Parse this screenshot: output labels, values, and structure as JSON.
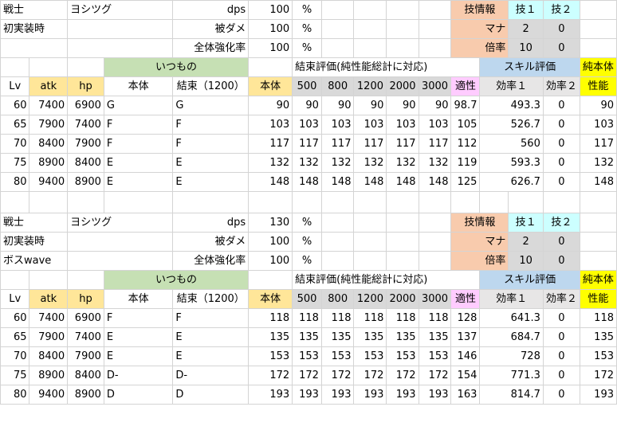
{
  "blocks": [
    {
      "row1": {
        "class": "戦士",
        "name": "ヨシツグ",
        "dps_label": "dps",
        "dps_value": "100",
        "dps_unit": "%",
        "skill_info": "技情報",
        "skill1": "技１",
        "skill2": "技２"
      },
      "row2": {
        "col_a": "初実装時",
        "col_b": "",
        "dmg_label": "被ダメ",
        "dmg_value": "100",
        "dmg_unit": "%",
        "mana_label": "マナ",
        "mana1": "2",
        "mana2": "0"
      },
      "row3": {
        "col_a": "",
        "col_b": "",
        "boost_label": "全体強化率",
        "boost_value": "100",
        "boost_unit": "%",
        "mult_label": "倍率",
        "mult1": "10",
        "mult2": "0"
      },
      "row4": {
        "itsumono": "いつもの",
        "kessoku_eval": "結束評価(純性能総計に対応)",
        "skill_eval": "スキル評価",
        "pure1": "純本体"
      },
      "row5": {
        "lv": "Lv",
        "atk": "atk",
        "hp": "hp",
        "hontai": "本体",
        "kessoku": "結束（1200）",
        "hontai2": "本体",
        "c500": "500",
        "c800": "800",
        "c1200": "1200",
        "c2000": "2000",
        "c3000": "3000",
        "tekisei": "適性",
        "eff1": "効率１",
        "eff2": "効率２",
        "pure2": "性能"
      },
      "rows": [
        [
          "60",
          "7400",
          "6900",
          "G",
          "G",
          "90",
          "90",
          "90",
          "90",
          "90",
          "90",
          "98.7",
          "493.3",
          "0",
          "90"
        ],
        [
          "65",
          "7900",
          "7400",
          "F",
          "F",
          "103",
          "103",
          "103",
          "103",
          "103",
          "103",
          "105",
          "526.7",
          "0",
          "103"
        ],
        [
          "70",
          "8400",
          "7900",
          "F",
          "F",
          "117",
          "117",
          "117",
          "117",
          "117",
          "117",
          "112",
          "560",
          "0",
          "117"
        ],
        [
          "75",
          "8900",
          "8400",
          "E",
          "E",
          "132",
          "132",
          "132",
          "132",
          "132",
          "132",
          "119",
          "593.3",
          "0",
          "132"
        ],
        [
          "80",
          "9400",
          "8900",
          "E",
          "E",
          "148",
          "148",
          "148",
          "148",
          "148",
          "148",
          "125",
          "626.7",
          "0",
          "148"
        ]
      ]
    },
    {
      "row1": {
        "class": "戦士",
        "name": "ヨシツグ",
        "dps_label": "dps",
        "dps_value": "130",
        "dps_unit": "%",
        "skill_info": "技情報",
        "skill1": "技１",
        "skill2": "技２"
      },
      "row2": {
        "col_a": "初実装時",
        "col_b": "",
        "dmg_label": "被ダメ",
        "dmg_value": "100",
        "dmg_unit": "%",
        "mana_label": "マナ",
        "mana1": "2",
        "mana2": "0"
      },
      "row3": {
        "col_a": "ボスwave",
        "col_b": "",
        "boost_label": "全体強化率",
        "boost_value": "100",
        "boost_unit": "%",
        "mult_label": "倍率",
        "mult1": "10",
        "mult2": "0"
      },
      "row4": {
        "itsumono": "いつもの",
        "kessoku_eval": "結束評価(純性能総計に対応)",
        "skill_eval": "スキル評価",
        "pure1": "純本体"
      },
      "row5": {
        "lv": "Lv",
        "atk": "atk",
        "hp": "hp",
        "hontai": "本体",
        "kessoku": "結束（1200）",
        "hontai2": "本体",
        "c500": "500",
        "c800": "800",
        "c1200": "1200",
        "c2000": "2000",
        "c3000": "3000",
        "tekisei": "適性",
        "eff1": "効率１",
        "eff2": "効率２",
        "pure2": "性能"
      },
      "rows": [
        [
          "60",
          "7400",
          "6900",
          "F",
          "F",
          "118",
          "118",
          "118",
          "118",
          "118",
          "118",
          "128",
          "641.3",
          "0",
          "118"
        ],
        [
          "65",
          "7900",
          "7400",
          "E",
          "E",
          "135",
          "135",
          "135",
          "135",
          "135",
          "135",
          "137",
          "684.7",
          "0",
          "135"
        ],
        [
          "70",
          "8400",
          "7900",
          "E",
          "E",
          "153",
          "153",
          "153",
          "153",
          "153",
          "153",
          "146",
          "728",
          "0",
          "153"
        ],
        [
          "75",
          "8900",
          "8400",
          "D-",
          "D-",
          "172",
          "172",
          "172",
          "172",
          "172",
          "172",
          "154",
          "771.3",
          "0",
          "172"
        ],
        [
          "80",
          "9400",
          "8900",
          "D",
          "D",
          "193",
          "193",
          "193",
          "193",
          "193",
          "193",
          "163",
          "814.7",
          "0",
          "193"
        ]
      ]
    }
  ]
}
